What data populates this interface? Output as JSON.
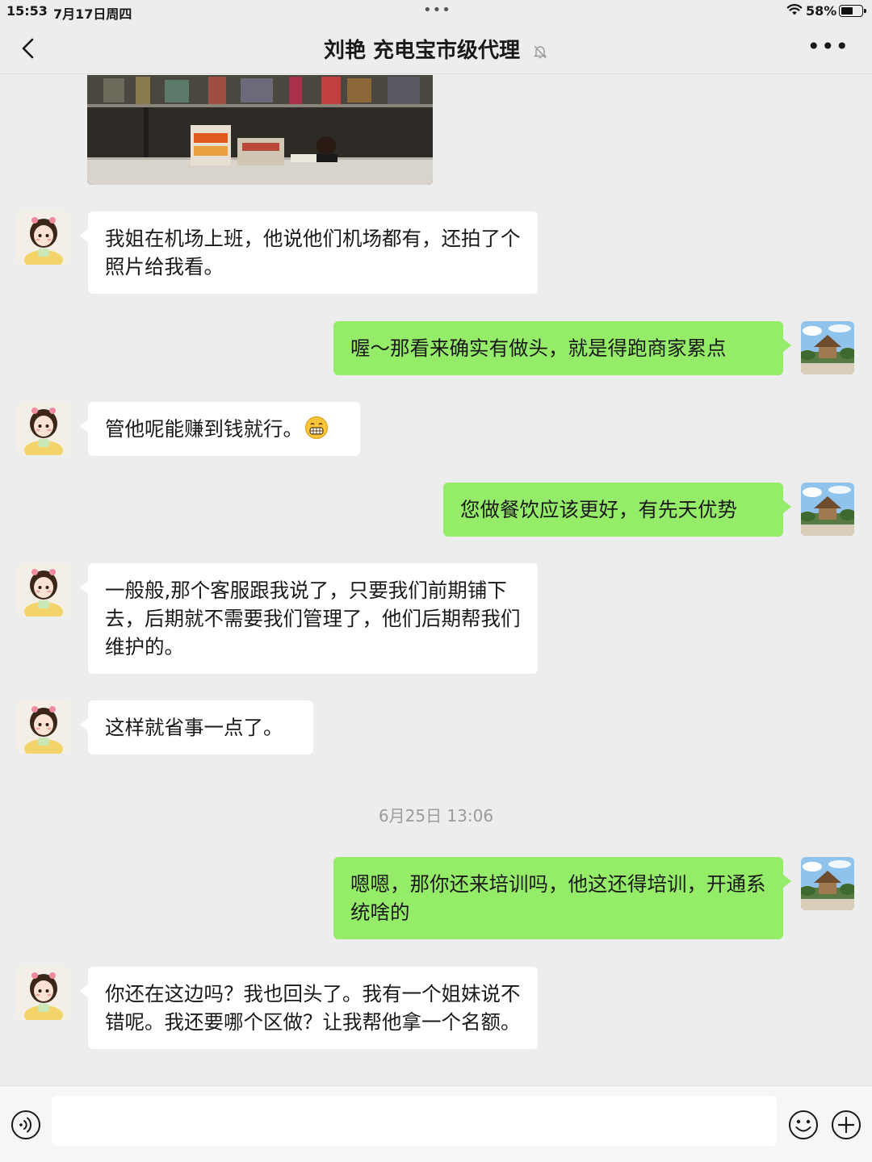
{
  "status_bar": {
    "time": "15:53",
    "date": "7月17日周四",
    "battery_pct": "58%",
    "battery_level": 0.58
  },
  "header": {
    "title": "刘艳 充电宝市级代理",
    "muted_icon": "bell-slash-icon",
    "back_icon": "chevron-left-icon",
    "more_icon": "more-dots-icon"
  },
  "messages": [
    {
      "side": "left",
      "text": "我姐在机场上班，他说他们机场都有，还拍了个照片给我看。"
    },
    {
      "side": "right",
      "text": "喔～那看来确实有做头，就是得跑商家累点"
    },
    {
      "side": "left",
      "text": "管他呢能赚到钱就行。",
      "emoji": "grin-emoji-icon"
    },
    {
      "side": "right",
      "text": "您做餐饮应该更好，有先天优势"
    },
    {
      "side": "left",
      "text": "一般般,那个客服跟我说了，只要我们前期铺下去，后期就不需要我们管理了，他们后期帮我们维护的。"
    },
    {
      "side": "left",
      "text": "这样就省事一点了。"
    },
    {
      "side": "right",
      "text": "嗯嗯，那你还来培训吗，他这还得培训，开通系统啥的"
    },
    {
      "side": "left",
      "text": "你还在这边吗？我也回头了。我有一个姐妹说不错呢。我还要哪个区做？让我帮他拿一个名额。"
    }
  ],
  "time_divider": "6月25日 13:06",
  "input_bar": {
    "voice_icon": "voice-icon",
    "emoji_icon": "emoji-icon",
    "plus_icon": "plus-icon",
    "placeholder": ""
  },
  "colors": {
    "background": "#ededed",
    "bubble_left": "#ffffff",
    "bubble_right": "#95ec69"
  }
}
